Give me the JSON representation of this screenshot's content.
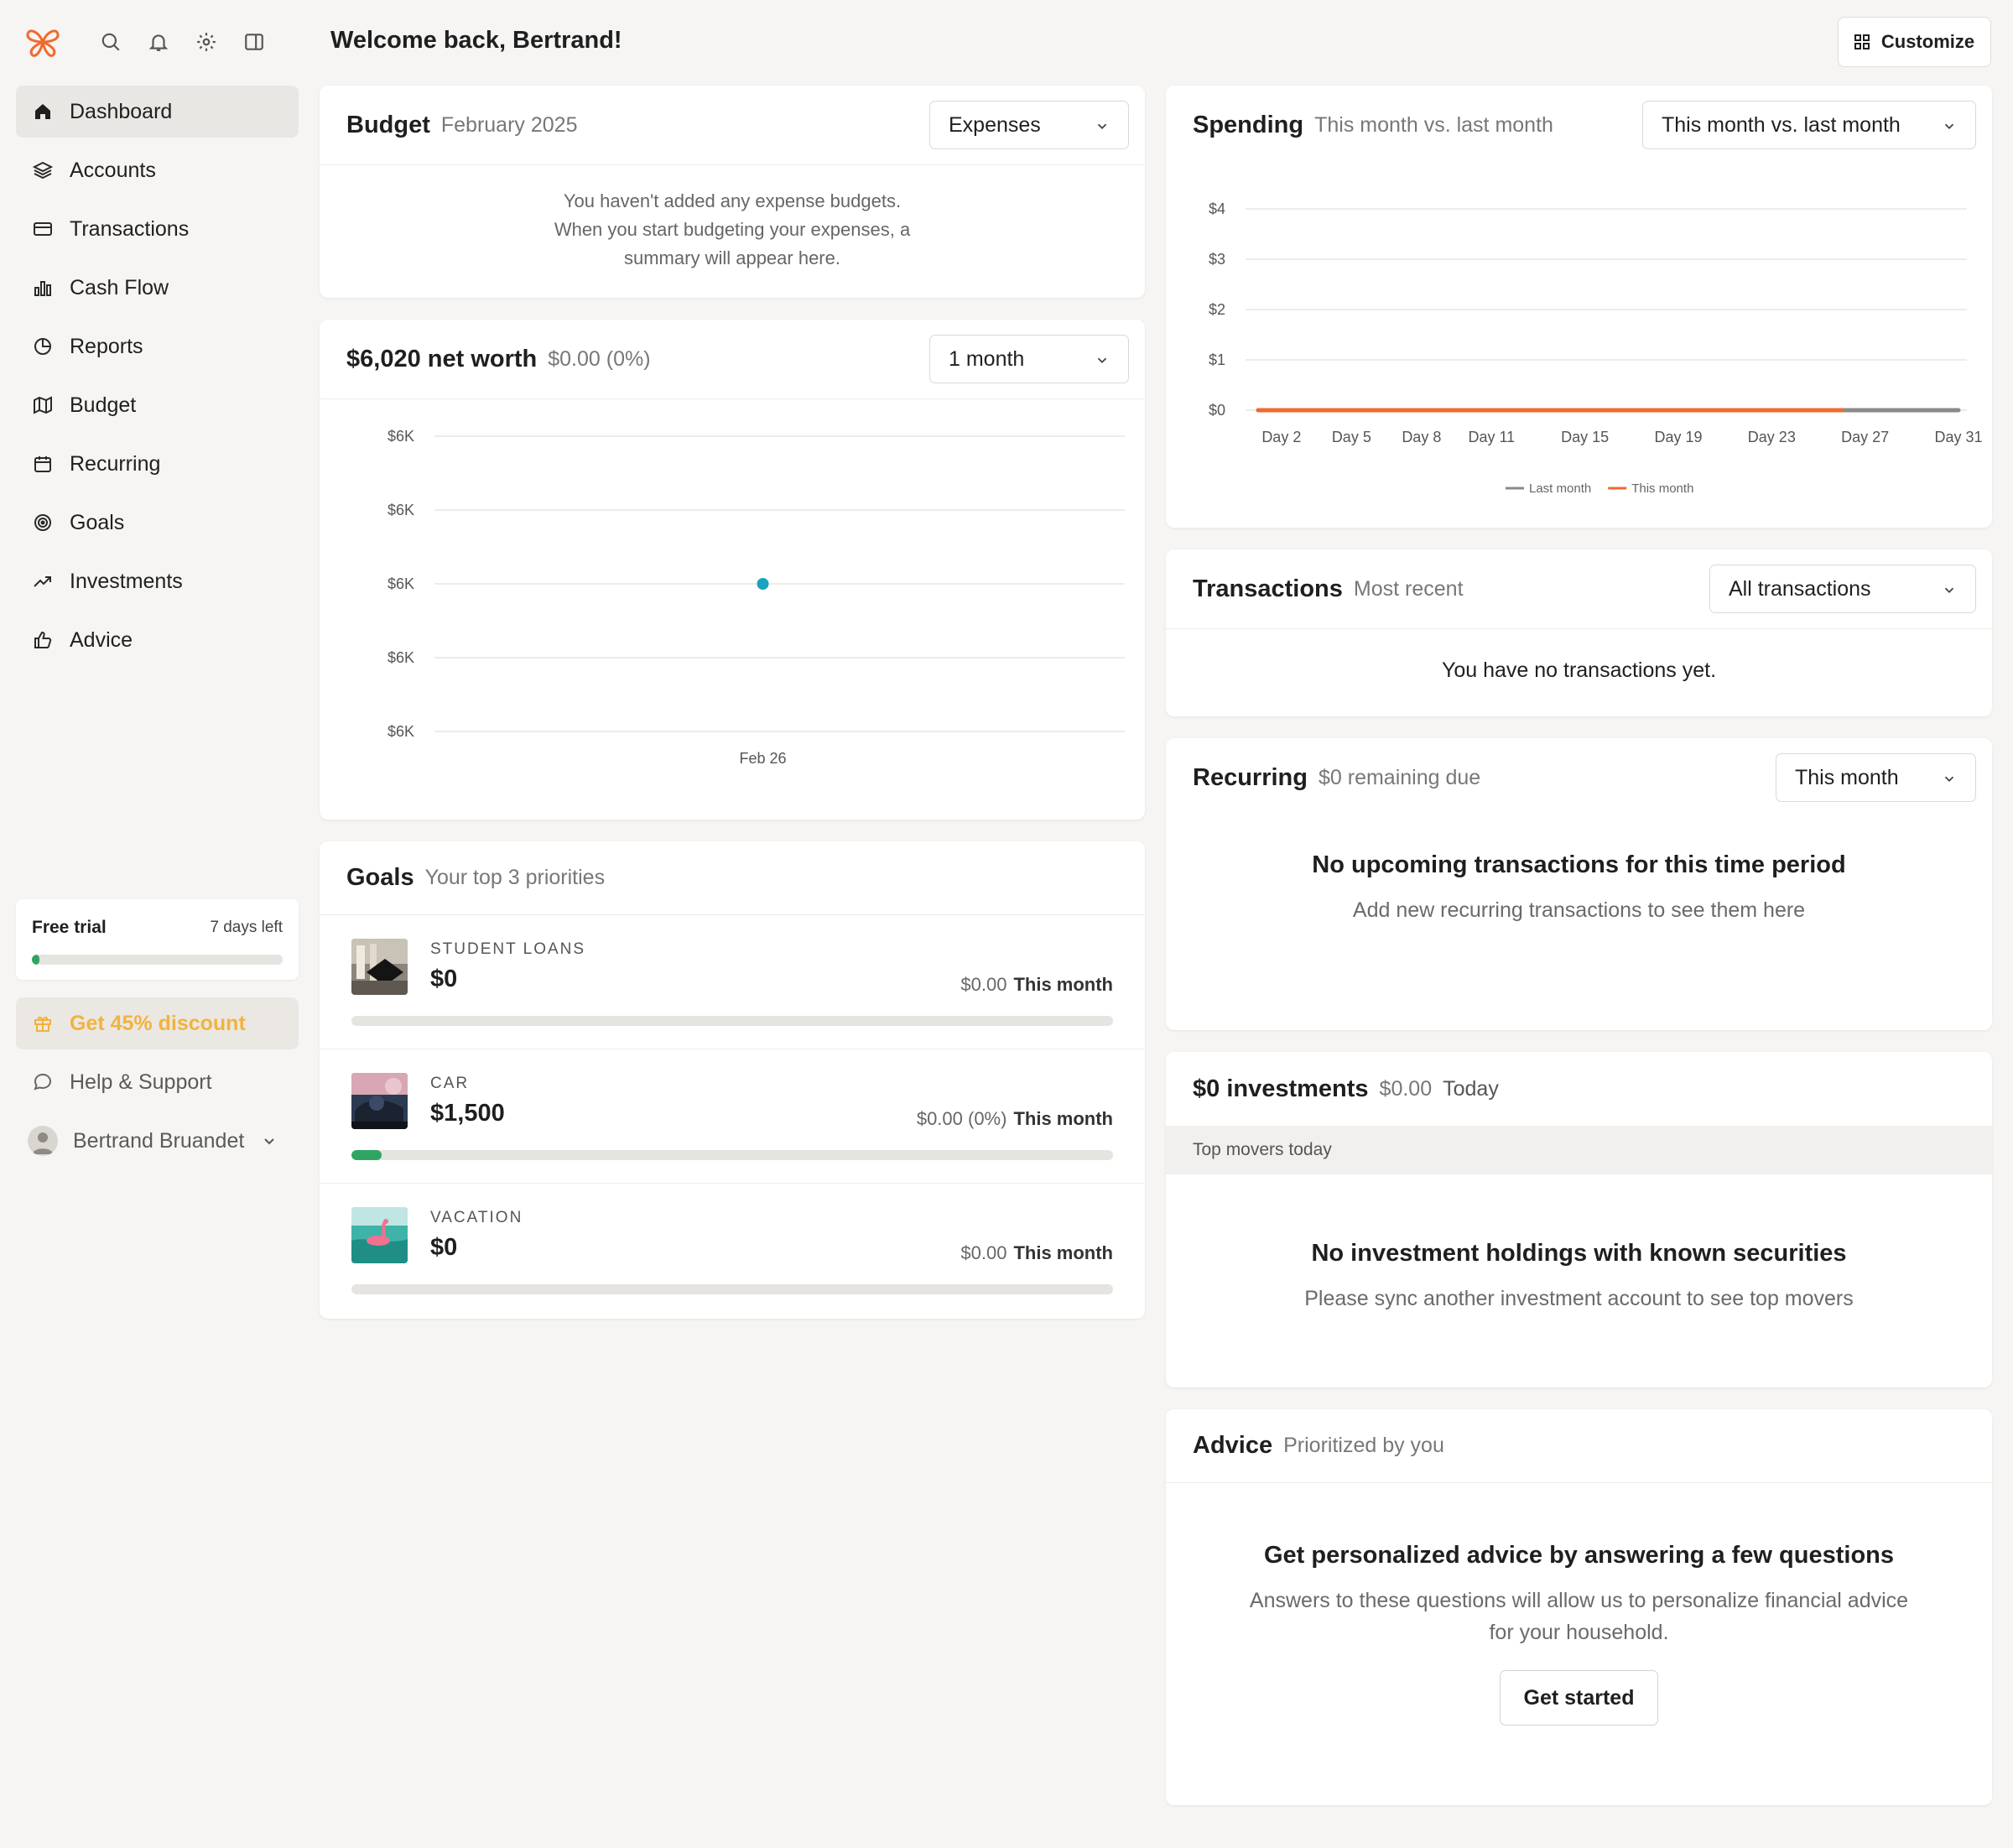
{
  "sidebar": {
    "nav": [
      {
        "label": "Dashboard",
        "icon": "home-icon",
        "active": true
      },
      {
        "label": "Accounts",
        "icon": "layers-icon"
      },
      {
        "label": "Transactions",
        "icon": "card-icon"
      },
      {
        "label": "Cash Flow",
        "icon": "bar-chart-icon"
      },
      {
        "label": "Reports",
        "icon": "pie-chart-icon"
      },
      {
        "label": "Budget",
        "icon": "map-icon"
      },
      {
        "label": "Recurring",
        "icon": "calendar-icon"
      },
      {
        "label": "Goals",
        "icon": "target-icon"
      },
      {
        "label": "Investments",
        "icon": "trend-icon"
      },
      {
        "label": "Advice",
        "icon": "thumbs-up-icon"
      }
    ],
    "trial": {
      "title": "Free trial",
      "days_left": "7 days left",
      "progress": 0.03
    },
    "discount": "Get 45% discount",
    "help": "Help & Support",
    "user_name": "Bertrand Bruandet"
  },
  "header": {
    "welcome": "Welcome back, Bertrand!",
    "customize": "Customize"
  },
  "budget": {
    "title": "Budget",
    "subtitle": "February 2025",
    "select": "Expenses",
    "empty": [
      "You haven't added any expense budgets.",
      "When you start budgeting your expenses, a",
      "summary will appear here."
    ]
  },
  "networth": {
    "title": "$6,020 net worth",
    "subtitle": "$0.00 (0%)",
    "select": "1 month"
  },
  "goals": {
    "title": "Goals",
    "subtitle": "Your top 3 priorities",
    "items": [
      {
        "name": "STUDENT LOANS",
        "amount": "$0",
        "change": "$0.00",
        "period": "This month",
        "progress": 0
      },
      {
        "name": "CAR",
        "amount": "$1,500",
        "change": "$0.00 (0%)",
        "period": "This month",
        "progress": 0.04
      },
      {
        "name": "VACATION",
        "amount": "$0",
        "change": "$0.00",
        "period": "This month",
        "progress": 0
      }
    ]
  },
  "spending": {
    "title": "Spending",
    "subtitle": "This month vs. last month",
    "select": "This month vs. last month"
  },
  "transactions": {
    "title": "Transactions",
    "subtitle": "Most recent",
    "select": "All transactions",
    "empty": "You have no transactions yet."
  },
  "recurring": {
    "title": "Recurring",
    "subtitle": "$0 remaining due",
    "select": "This month",
    "empty_title": "No upcoming transactions for this time period",
    "empty_text": "Add new recurring transactions to see them here"
  },
  "investments": {
    "title": "$0 investments",
    "subtitle_value": "$0.00",
    "subtitle_period": "Today",
    "movers": "Top movers today",
    "empty_title": "No investment holdings with known securities",
    "empty_text": "Please sync another investment account to see top movers"
  },
  "advice": {
    "title": "Advice",
    "subtitle": "Prioritized by you",
    "empty_title": "Get personalized advice by answering a few questions",
    "empty_text": [
      "Answers to these questions will allow us to personalize financial advice",
      "for your household."
    ],
    "button": "Get started"
  },
  "chart_data": [
    {
      "type": "scatter",
      "y_tick_labels": [
        "$6K",
        "$6K",
        "$6K",
        "$6K",
        "$6K"
      ],
      "x_tick_labels": [
        "Feb 26"
      ],
      "points": [
        {
          "x": "Feb 26",
          "y": 6020
        }
      ],
      "color": "#19a3c0",
      "grid": true
    },
    {
      "type": "line",
      "categories": [
        "Day 2",
        "Day 5",
        "Day 8",
        "Day 11",
        "Day 15",
        "Day 19",
        "Day 23",
        "Day 27",
        "Day 31"
      ],
      "y_tick_labels": [
        "$4",
        "$3",
        "$2",
        "$1",
        "$0"
      ],
      "ylim": [
        0,
        4
      ],
      "x_range_days": [
        1,
        31
      ],
      "series": [
        {
          "name": "Last month",
          "color": "#8a8a8a",
          "days": [
            1,
            31
          ],
          "values": [
            0,
            0
          ]
        },
        {
          "name": "This month",
          "color": "#f06a2e",
          "days": [
            1,
            26
          ],
          "values": [
            0,
            0
          ]
        }
      ],
      "legend": "bottom",
      "grid": true
    }
  ]
}
